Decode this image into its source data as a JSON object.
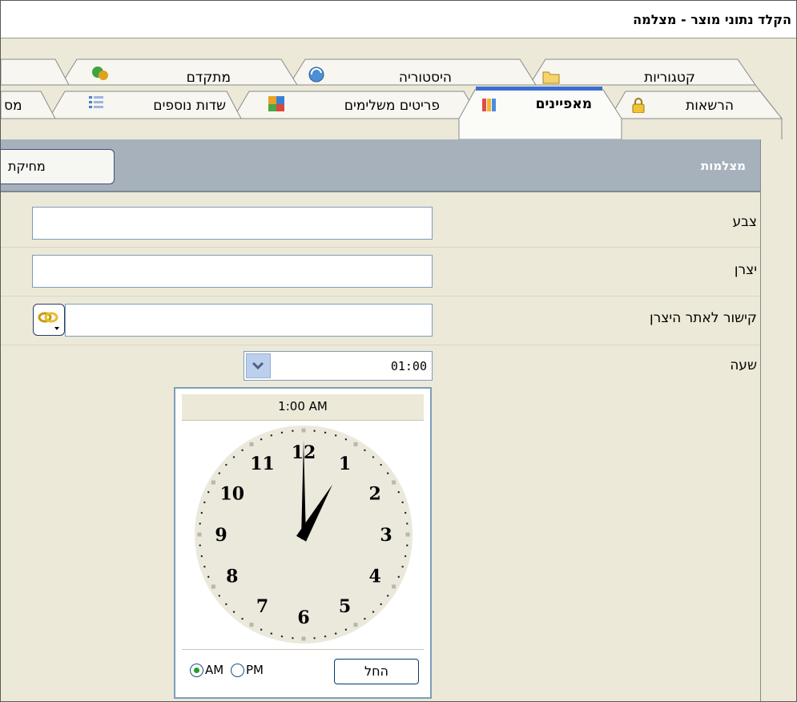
{
  "window": {
    "title": "הקלד נתוני מוצר - מצלמה"
  },
  "tabs": {
    "back_row": [
      {
        "label": "קטגוריות",
        "icon": "folder-icon"
      },
      {
        "label": "היסטוריה",
        "icon": "history-icon"
      },
      {
        "label": "מתקדם",
        "icon": "advanced-icon"
      }
    ],
    "front_row": [
      {
        "label": "הרשאות",
        "icon": "lock-icon"
      },
      {
        "label": "מאפיינים",
        "icon": "books-icon",
        "active": true
      },
      {
        "label": "פריטים משלימים",
        "icon": "puzzle-icon"
      },
      {
        "label": "שדות נוספים",
        "icon": "list-icon"
      },
      {
        "label": "מס"
      }
    ]
  },
  "panel": {
    "title": "מצלמות",
    "delete_button": "מחיקת"
  },
  "fields": {
    "color": {
      "label": "צבע",
      "value": ""
    },
    "manufacturer": {
      "label": "יצרן",
      "value": ""
    },
    "manufacturer_link": {
      "label": "קישור לאתר היצרן",
      "value": "",
      "button_icon": "link-chain-icon"
    },
    "time": {
      "label": "שעה",
      "value": "01:00"
    }
  },
  "clock": {
    "header": "1:00 AM",
    "hour": 1,
    "minute": 0,
    "numbers": [
      "12",
      "1",
      "2",
      "3",
      "4",
      "5",
      "6",
      "7",
      "8",
      "9",
      "10",
      "11"
    ],
    "am_label": "AM",
    "pm_label": "PM",
    "selected_period": "AM",
    "start_button": "החל"
  },
  "colors": {
    "panel_header": "#a6b1bc",
    "tab_active_accent": "#3c6ed0",
    "window_bg": "#ece9d8",
    "input_border": "#7f9db9"
  }
}
